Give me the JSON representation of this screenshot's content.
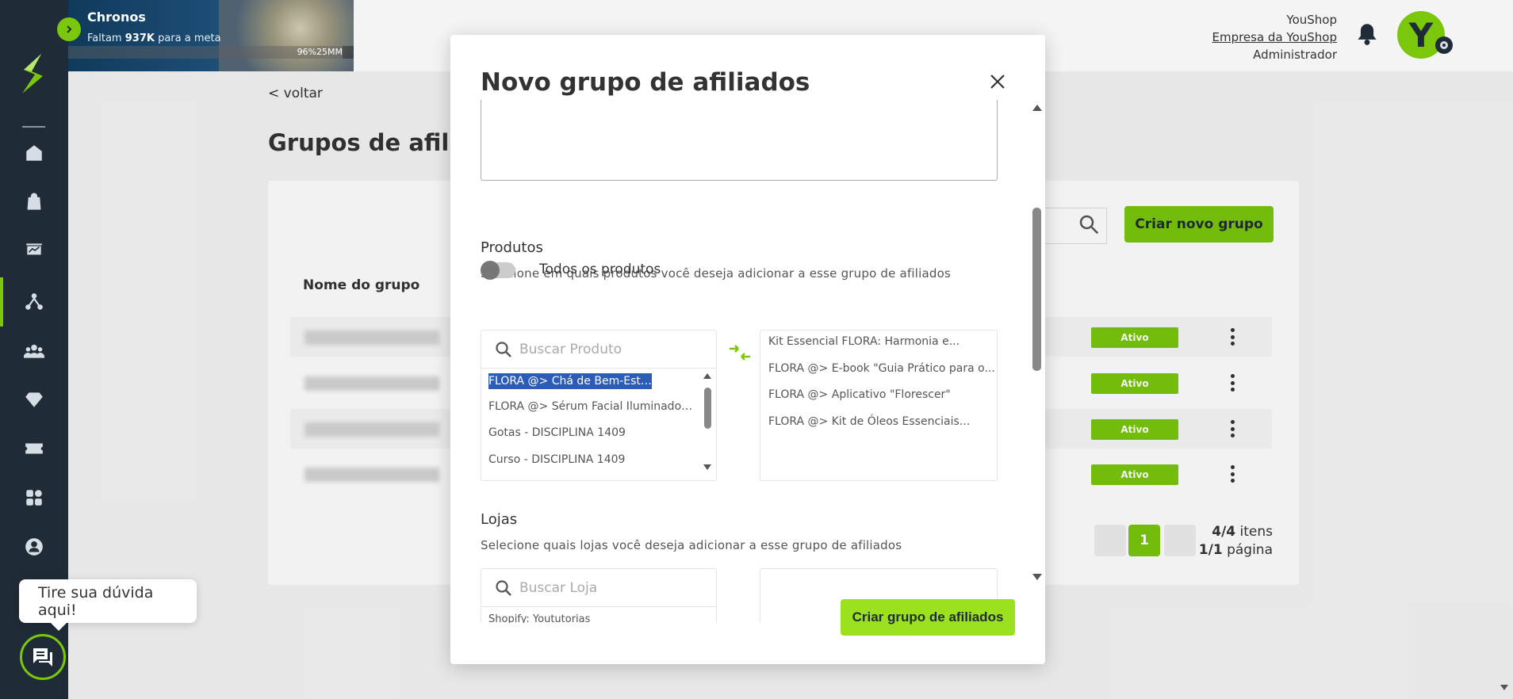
{
  "banner": {
    "title": "Chronos",
    "subtitle_prefix": "Faltam ",
    "subtitle_bold": "937K",
    "subtitle_suffix": " para a meta",
    "progress_text": "96%25MM",
    "progress_fraction": 0.96
  },
  "header": {
    "store_name": "YouShop",
    "company_link": "Empresa da YouShop",
    "role": "Administrador",
    "avatar_letter": "Y"
  },
  "page": {
    "back_link": "< voltar",
    "title": "Grupos de afiliados",
    "create_button": "Criar novo grupo",
    "column_header": "Nome do grupo",
    "rows": [
      {
        "status": "Ativo"
      },
      {
        "status": "Ativo"
      },
      {
        "status": "Ativo"
      },
      {
        "status": "Ativo"
      }
    ],
    "pager": {
      "current_page": "1",
      "items_bold": "4/4",
      "items_label": " itens",
      "pages_bold": "1/1",
      "pages_label": " página"
    }
  },
  "modal": {
    "title": "Novo grupo de afiliados",
    "products": {
      "title": "Produtos",
      "description": "Selecione em quais produtos você deseja adicionar a esse grupo de afiliados",
      "toggle_label": "Todos os produtos",
      "search_placeholder": "Buscar Produto",
      "available": [
        "FLORA @> Chá de Bem-Estar...",
        "FLORA @> Sérum Facial Iluminador...",
        "Gotas - DISCIPLINA 1409",
        "Curso - DISCIPLINA 1409"
      ],
      "selected": [
        "Kit Essencial FLORA: Harmonia e...",
        "FLORA @> E-book \"Guia Prático para o...",
        "FLORA @> Aplicativo \"Florescer\"",
        "FLORA @> Kit de Óleos Essenciais..."
      ]
    },
    "stores": {
      "title": "Lojas",
      "description": "Selecione quais lojas você deseja adicionar a esse grupo de afiliados",
      "search_placeholder": "Buscar Loja",
      "available": [
        "Shopify: Yoututorias"
      ]
    },
    "submit_button": "Criar grupo de afiliados"
  },
  "help": {
    "bubble_text": "Tire sua dúvida aqui!"
  },
  "colors": {
    "brand_green": "#7ac70c",
    "sidebar": "#1f2b36",
    "submit_green": "#9be11e",
    "selection_blue": "#2a5cb8"
  }
}
